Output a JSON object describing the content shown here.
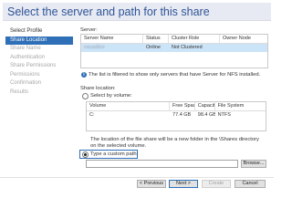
{
  "title": "Select the server and path for this share",
  "nav": [
    {
      "label": "Select Profile",
      "state": "enabled"
    },
    {
      "label": "Share Location",
      "state": "active"
    },
    {
      "label": "Share Name",
      "state": "disabled"
    },
    {
      "label": "Authentication",
      "state": "disabled"
    },
    {
      "label": "Share Permissions",
      "state": "disabled"
    },
    {
      "label": "Permissions",
      "state": "disabled"
    },
    {
      "label": "Confirmation",
      "state": "disabled"
    },
    {
      "label": "Results",
      "state": "disabled"
    }
  ],
  "server": {
    "label": "Server:",
    "columns": [
      "Server Name",
      "Status",
      "Cluster Role",
      "Owner Node"
    ],
    "rows": [
      [
        "nasadbor",
        "Online",
        "Not Clustered",
        ""
      ]
    ]
  },
  "filter_note": "The list is filtered to show only servers that have Server for NFS installed.",
  "share_location": {
    "label": "Share location:",
    "by_volume_label": "Select by volume:",
    "columns": [
      "Volume",
      "Free Space",
      "Capacity",
      "File System"
    ],
    "rows": [
      [
        "C:",
        "77.4 GB",
        "98.4 GB",
        "NTFS"
      ]
    ]
  },
  "location_note": "The location of the file share will be a new folder in the \\Shares directory on the selected volume.",
  "custom_path": {
    "label": "Type a custom path:",
    "value": "",
    "browse_label": "Browse..."
  },
  "buttons": {
    "previous": "< Previous",
    "next": "Next >",
    "create": "Create",
    "cancel": "Cancel"
  }
}
